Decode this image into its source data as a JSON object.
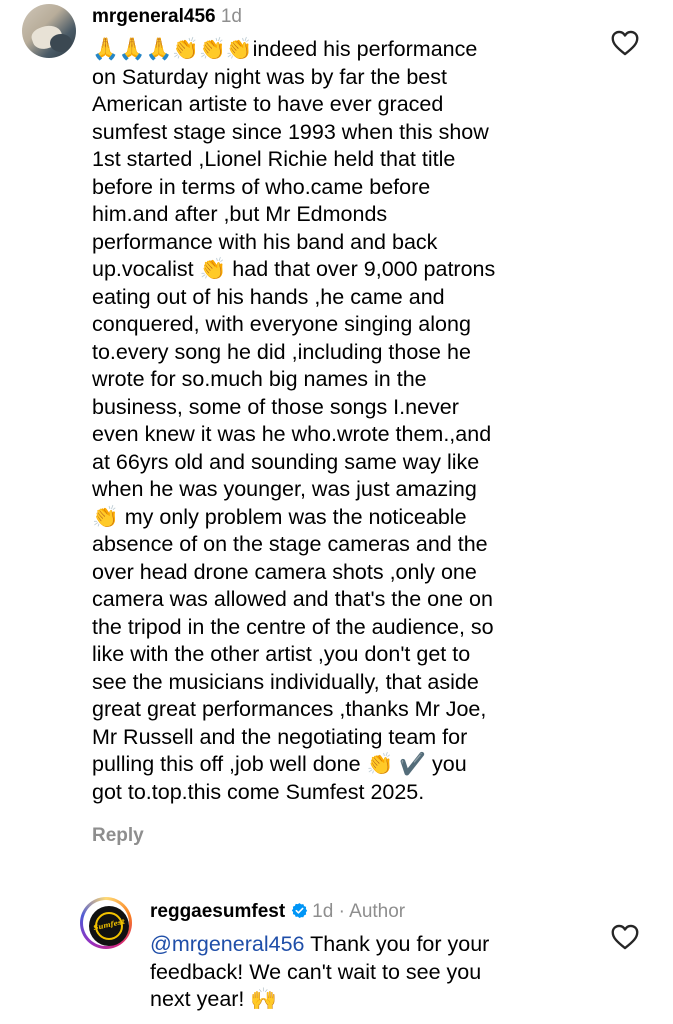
{
  "comments": [
    {
      "username": "mrgeneral456",
      "time": "1d",
      "text": "🙏🙏🙏👏👏👏indeed his performance\non Saturday night was by far the best\nAmerican artiste to have ever graced\nsumfest stage since 1993 when this show\n1st started ,Lionel Richie held that title\nbefore in terms of who.came before\nhim.and after ,but Mr Edmonds\nperformance with his band and back\nup.vocalist 👏 had that over 9,000 patrons\neating out of his hands ,he came and\nconquered, with everyone singing along\nto.every song he did ,including those he\nwrote for so.much big names in the\nbusiness, some of those songs I.never\neven knew it was he who.wrote them.,and\nat 66yrs old and sounding same way like\nwhen he was younger, was just amazing\n👏 my only problem was the noticeable\nabsence of on the stage cameras and the\nover head drone camera shots ,only one\ncamera was allowed and that's the one on\nthe tripod in the centre of the audience, so\nlike with the other artist ,you don't get to\nsee the musicians individually, that aside\ngreat great performances ,thanks Mr Joe,\nMr Russell and the negotiating team for\npulling this off ,job well done 👏 ✔️ you\ngot to.top.this come Sumfest 2025.",
      "reply_label": "Reply",
      "like_icon": "heart-outline-icon"
    },
    {
      "username": "reggaesumfest",
      "verified": true,
      "time": "1d",
      "separator": "·",
      "author_label": "Author",
      "mention": "@mrgeneral456",
      "text": " Thank you for your\nfeedback! We can't wait to see you\nnext year! 🙌",
      "avatar_logo_text": "Sumfest",
      "like_icon": "heart-outline-icon"
    }
  ],
  "colors": {
    "text": "#000000",
    "muted": "#8e8e8e",
    "mention": "#1f4ea8",
    "verified": "#0095f6"
  }
}
